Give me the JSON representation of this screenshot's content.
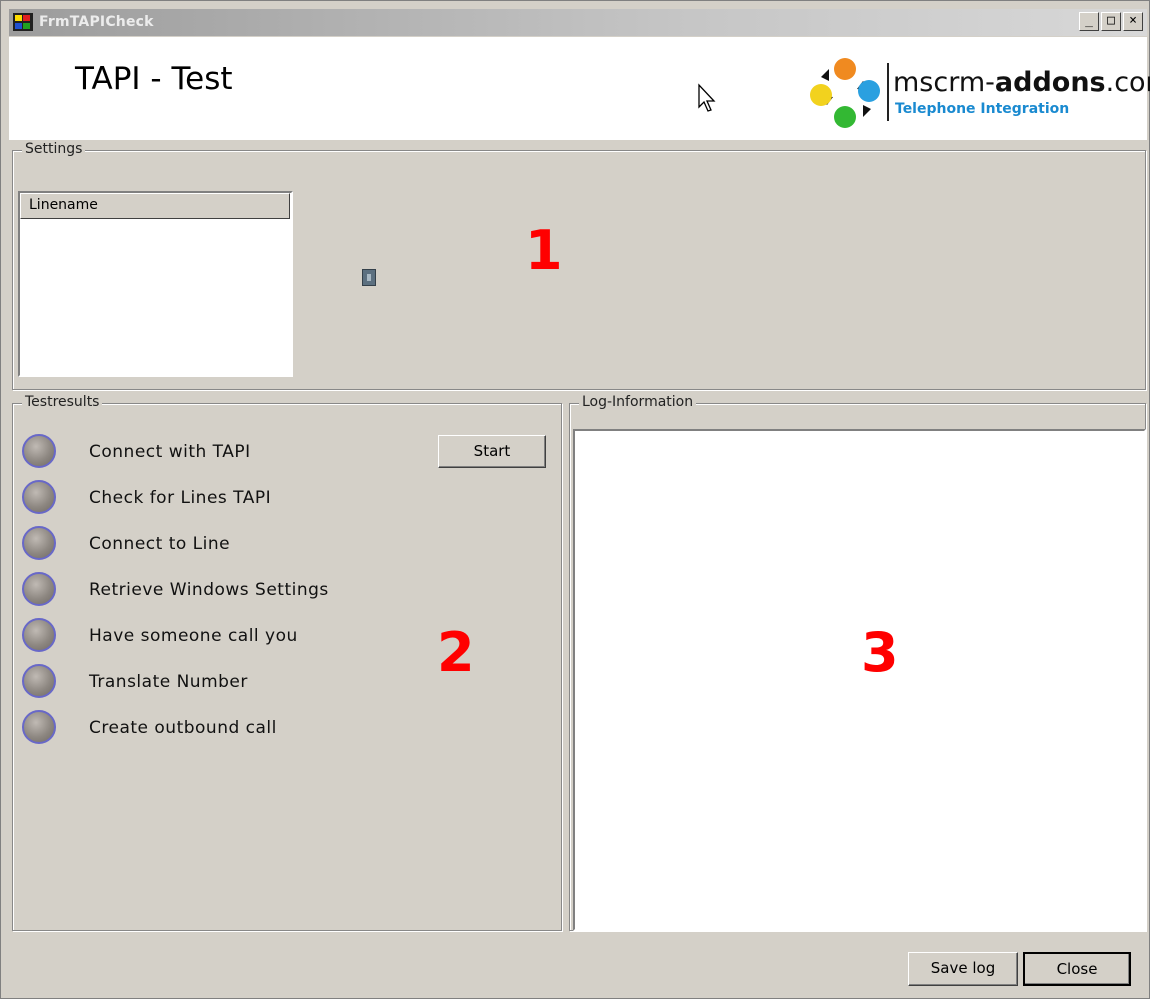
{
  "window": {
    "title": "FrmTAPICheck",
    "controls": {
      "minimize": "_",
      "maximize": "□",
      "close": "×"
    }
  },
  "header": {
    "heading": "TAPI - Test"
  },
  "logo": {
    "brand_prefix": "mscrm-",
    "brand_bold": "addons",
    "brand_suffix": ".com",
    "tagline": "Telephone Integration"
  },
  "settings": {
    "legend": "Settings",
    "list_header": "Linename",
    "marker": "1"
  },
  "testresults": {
    "legend": "Testresults",
    "marker": "2",
    "start_label": "Start",
    "steps": [
      {
        "label": "Connect with TAPI"
      },
      {
        "label": "Check for Lines TAPI"
      },
      {
        "label": "Connect to Line"
      },
      {
        "label": "Retrieve Windows Settings"
      },
      {
        "label": "Have someone call you"
      },
      {
        "label": "Translate Number"
      },
      {
        "label": "Create outbound call"
      }
    ]
  },
  "log": {
    "legend": "Log-Information",
    "marker": "3"
  },
  "footer": {
    "save_label": "Save log",
    "close_label": "Close"
  }
}
